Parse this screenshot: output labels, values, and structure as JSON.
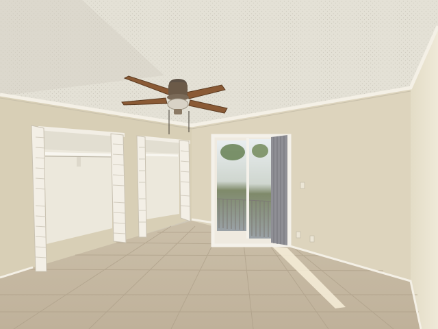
{
  "scene": {
    "subject": "empty-bedroom-interior",
    "colors": {
      "ceiling": "#e4e1d6",
      "wall_back": "#ddd4bd",
      "wall_left": "#d8cfb6",
      "wall_right": "#e6dfca",
      "floor": "#c9bca6",
      "closet_interior": "#ece8dc",
      "louver_door": "#f3efe6",
      "trim": "#f2eee5",
      "fan_blade": "#8a5a35",
      "fan_body": "#6b5a48",
      "curtain": "#8f8f95",
      "window_sky": "#dfe8ee",
      "sunlight": "#f7efd9"
    }
  }
}
